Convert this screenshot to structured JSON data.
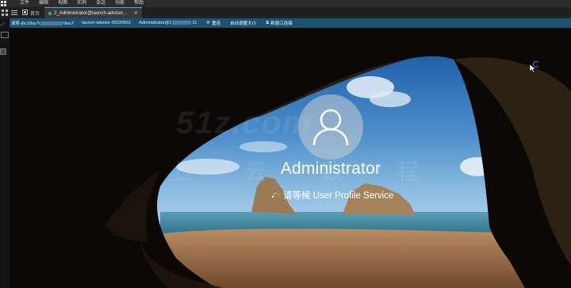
{
  "menubar": {
    "items": [
      "文件",
      "编辑",
      "视图",
      "实例",
      "会话",
      "功能",
      "帮助"
    ]
  },
  "tabs": {
    "home_label": "首页",
    "session_label": "2_Administrator@launch-advisor..."
  },
  "infobar": {
    "host_prefix": "请将-j6c10oy7i",
    "host_suffix": "0wu7",
    "instance": "launch-advisor-20220601",
    "user_prefix": "Administrator@1",
    "user_suffix": "31",
    "reconnect_label": "重连",
    "autosize_label": "自动调整大小",
    "newwindow_label": "新窗口连接"
  },
  "lockscreen": {
    "username": "Administrator",
    "status": "请等候 User Profile Service",
    "watermark_text": "51z.com",
    "watermark_cn": "上云数程"
  },
  "icons": {
    "app": "app-menu-icon",
    "grid": "grid-icon",
    "home": "home-icon",
    "pin": "pin-icon",
    "reconnect": "reconnect-icon",
    "newwindow": "new-window-icon"
  },
  "colors": {
    "infobar": "#1a5274",
    "tab_accent": "#4fa3e0",
    "status_dot": "#3fbf5a"
  }
}
